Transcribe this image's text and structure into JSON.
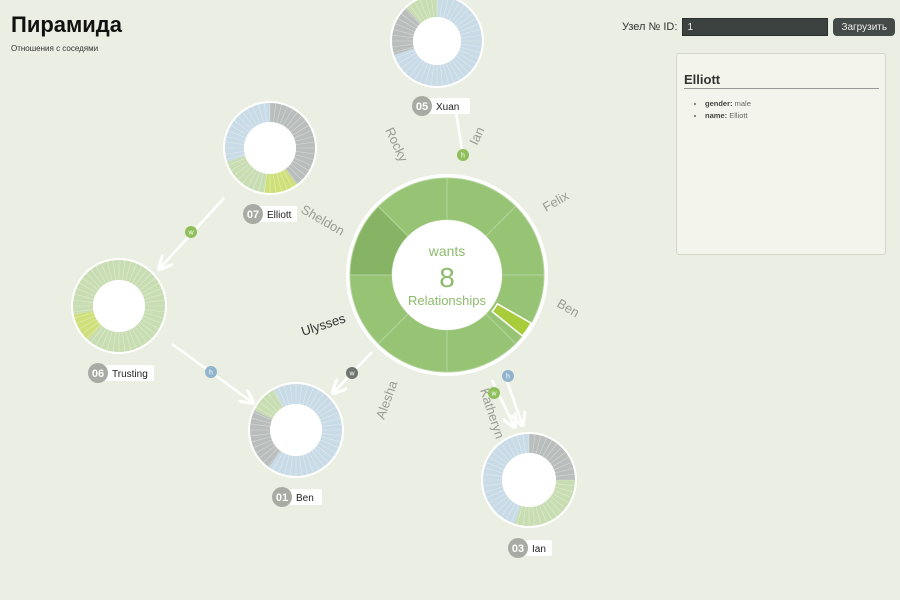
{
  "header": {
    "title": "Пирамида",
    "subtitle": "Отношения с соседями"
  },
  "id_form": {
    "label": "Узел № ID:",
    "value": "1",
    "button_label": "Загрузить"
  },
  "detail_panel": {
    "name": "Elliott",
    "attributes": [
      {
        "key": "gender:",
        "value": "male"
      },
      {
        "key": "name:",
        "value": "Elliott"
      }
    ]
  },
  "center": {
    "line1": "wants",
    "count": "8",
    "line3": "Relationships"
  },
  "relationship_labels": [
    {
      "text": "Rocky"
    },
    {
      "text": "Ian"
    },
    {
      "text": "Felix"
    },
    {
      "text": "Ben"
    },
    {
      "text": "Sheldon"
    },
    {
      "text": "Ulysses"
    },
    {
      "text": "Alesha"
    },
    {
      "text": "Katheryn"
    }
  ],
  "nodes": [
    {
      "num": "05",
      "name": "Xuan",
      "segments": [
        {
          "color": "#c8dbe6",
          "value": 70
        },
        {
          "color": "#b9bdbb",
          "value": 18
        },
        {
          "color": "#c8ddb2",
          "value": 12
        }
      ]
    },
    {
      "num": "07",
      "name": "Elliott",
      "segments": [
        {
          "color": "#b9bdbb",
          "value": 40
        },
        {
          "color": "#cfe07b",
          "value": 12
        },
        {
          "color": "#c8ddb2",
          "value": 18
        },
        {
          "color": "#c8dbe6",
          "value": 30
        }
      ]
    },
    {
      "num": "06",
      "name": "Trusting",
      "segments": [
        {
          "color": "#c8ddb2",
          "value": 62
        },
        {
          "color": "#cfe07b",
          "value": 10
        },
        {
          "color": "#c8ddb2",
          "value": 28
        }
      ]
    },
    {
      "num": "01",
      "name": "Ben",
      "segments": [
        {
          "color": "#c8dbe6",
          "value": 60
        },
        {
          "color": "#b9bdbb",
          "value": 22
        },
        {
          "color": "#c8ddb2",
          "value": 10
        },
        {
          "color": "#c8dbe6",
          "value": 8
        }
      ]
    },
    {
      "num": "03",
      "name": "Ian",
      "segments": [
        {
          "color": "#b9bdbb",
          "value": 25
        },
        {
          "color": "#c8ddb2",
          "value": 30
        },
        {
          "color": "#c8dbe6",
          "value": 45
        }
      ]
    }
  ],
  "edge_badges": [
    {
      "letter": "h",
      "color": "#8fbf5a"
    },
    {
      "letter": "w",
      "color": "#8fbf5a"
    },
    {
      "letter": "h",
      "color": "#8fb4cc"
    },
    {
      "letter": "w",
      "color": "#6e7470"
    },
    {
      "letter": "w",
      "color": "#8fbf5a"
    },
    {
      "letter": "h",
      "color": "#8fb4cc"
    }
  ],
  "colors": {
    "center_main": "#96c474",
    "center_dark": "#86b464",
    "center_highlight": "#a9cc3a",
    "center_text": "#8dbb6d",
    "arrow": "#ffffff",
    "number_circle": "#a8aba3"
  }
}
